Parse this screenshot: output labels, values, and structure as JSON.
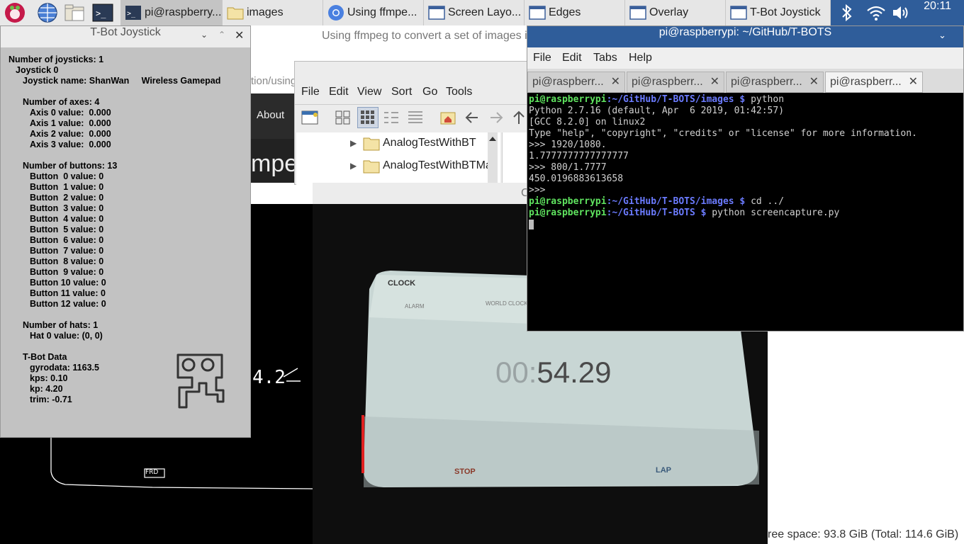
{
  "taskbar": {
    "tasks": [
      {
        "label": "pi@raspberry...",
        "active": true
      },
      {
        "label": "images"
      },
      {
        "label": "Using ffmpe..."
      },
      {
        "label": "Screen Layo..."
      },
      {
        "label": "Edges"
      },
      {
        "label": "Overlay"
      },
      {
        "label": "T-Bot Joystick"
      }
    ],
    "clock": "20:11"
  },
  "browser": {
    "title": "Using ffmpeg to convert a set of images i",
    "url_fragment": "tion/using",
    "nav_about": "About",
    "heading_fragment": "mpe"
  },
  "file_manager": {
    "menu": [
      "File",
      "Edit",
      "View",
      "Sort",
      "Go",
      "Tools"
    ],
    "folders": [
      "AnalogTestWithBT",
      "AnalogTestWithBTMa"
    ],
    "status": "ree space: 93.8 GiB (Total: 114.6 GiB)"
  },
  "camera_window": {
    "title_fragment": "C",
    "display": {
      "brand": "CLOCK",
      "tabs": [
        "ALARM",
        "WORLD CLOCK"
      ],
      "time_dim": "00:",
      "time_main": "54.29",
      "buttons": [
        "STOP",
        "LAP"
      ]
    }
  },
  "joystick": {
    "title": "T-Bot Joystick",
    "lines": [
      "Number of joysticks: 1",
      "Joystick 0",
      "Joystick name: ShanWan     Wireless Gamepad",
      "Number of axes: 4",
      "Axis 0 value:  0.000",
      "Axis 1 value:  0.000",
      "Axis 2 value:  0.000",
      "Axis 3 value:  0.000",
      "Number of buttons: 13",
      "Button  0 value: 0",
      "Button  1 value: 0",
      "Button  2 value: 0",
      "Button  3 value: 0",
      "Button  4 value: 0",
      "Button  5 value: 0",
      "Button  6 value: 0",
      "Button  7 value: 0",
      "Button  8 value: 0",
      "Button  9 value: 0",
      "Button 10 value: 0",
      "Button 11 value: 0",
      "Button 12 value: 0",
      "Number of hats: 1",
      "Hat 0 value: (0, 0)",
      "T-Bot Data",
      "gyrodata: 1163.5",
      "kps: 0.10",
      "kp: 4.20",
      "trim: -0.71"
    ]
  },
  "terminal": {
    "title": "pi@raspberrypi: ~/GitHub/T-BOTS",
    "menu": [
      "File",
      "Edit",
      "Tabs",
      "Help"
    ],
    "tabs": [
      "pi@raspberr...",
      "pi@raspberr...",
      "pi@raspberr...",
      "pi@raspberr..."
    ],
    "lines": {
      "l1_user": "pi@raspberrypi",
      "l1_path": ":~/GitHub/T-BOTS/images $",
      "l1_cmd": " python",
      "l2": "Python 2.7.16 (default, Apr  6 2019, 01:42:57)",
      "l3": "[GCC 8.2.0] on linux2",
      "l4": "Type \"help\", \"copyright\", \"credits\" or \"license\" for more information.",
      "l5": ">>> 1920/1080.",
      "l6": "1.7777777777777777",
      "l7": ">>> 800/1.7777",
      "l8": "450.0196883613658",
      "l9": ">>>",
      "l10_user": "pi@raspberrypi",
      "l10_path": ":~/GitHub/T-BOTS/images $",
      "l10_cmd": " cd ../",
      "l11_user": "pi@raspberrypi",
      "l11_path": ":~/GitHub/T-BOTS $",
      "l11_cmd": " python screencapture.py"
    }
  },
  "edge_window": {
    "text_fragment": "4.2",
    "label_fragment": "FRD"
  }
}
